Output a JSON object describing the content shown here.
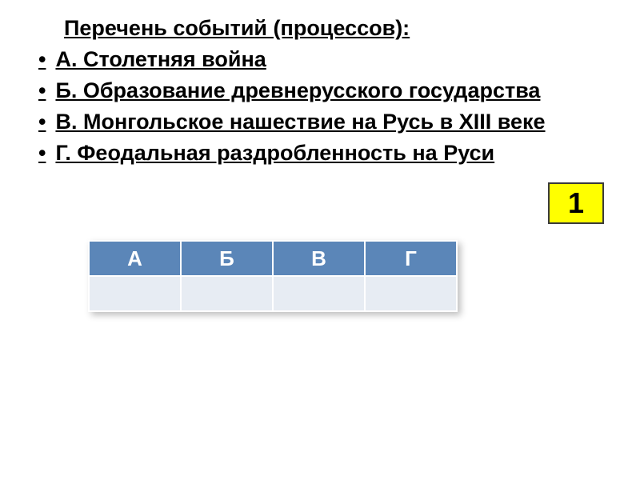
{
  "heading": "Перечень событий (процессов):",
  "items": [
    "А. Столетняя война",
    " Б. Образование древнерусского государства",
    "В. Монгольское нашествие на Русь в XIII веке",
    " Г. Феодальная раздробленность на Руси"
  ],
  "number_box": "1",
  "table": {
    "headers": [
      "А",
      "Б",
      "В",
      "Г"
    ]
  }
}
